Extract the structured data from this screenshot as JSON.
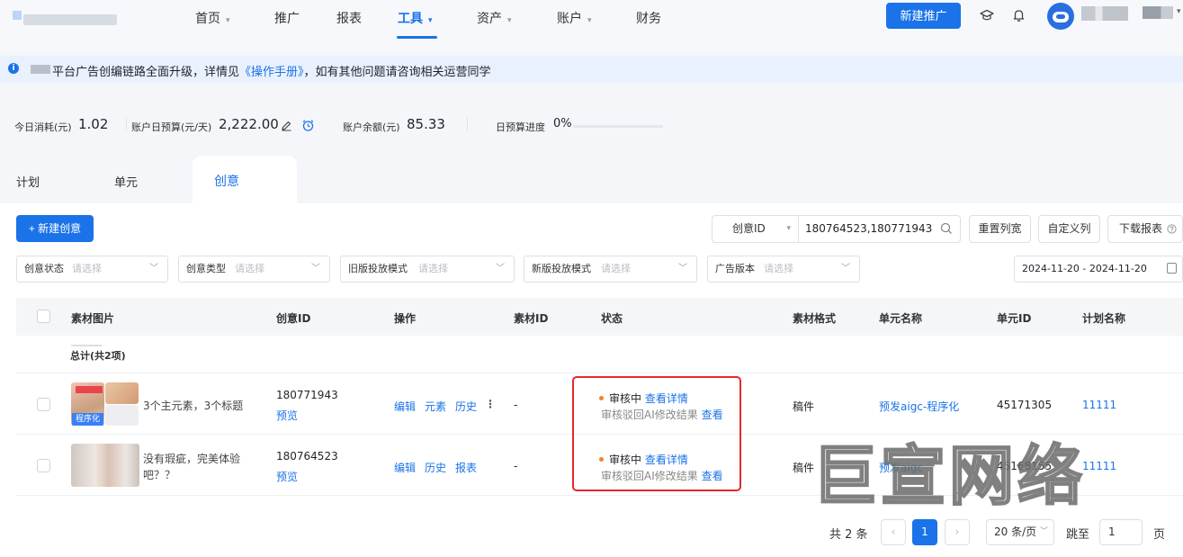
{
  "nav": {
    "items": [
      {
        "label": "首页",
        "caret": true
      },
      {
        "label": "推广",
        "caret": false
      },
      {
        "label": "报表",
        "caret": false
      },
      {
        "label": "工具",
        "caret": true,
        "active": true
      },
      {
        "label": "资产",
        "caret": true
      },
      {
        "label": "账户",
        "caret": true
      },
      {
        "label": "财务",
        "caret": false
      }
    ],
    "new_promo": "新建推广",
    "caret": "▾"
  },
  "notice": {
    "text_before": "平台广告创编链路全面升级，详情见",
    "link": "《操作手册》",
    "text_after": "，如有其他问题请咨询相关运营同学"
  },
  "stats": {
    "today_cost_label": "今日消耗(元)",
    "today_cost": "1.02",
    "daily_budget_label": "账户日预算(元/天)",
    "daily_budget": "2,222.00",
    "balance_label": "账户余额(元)",
    "balance": "85.33",
    "budget_progress_label": "日预算进度",
    "budget_progress": "0%",
    "budget_progress_fraction": 0
  },
  "tabs": [
    "计划",
    "单元",
    "创意"
  ],
  "active_tab": "创意",
  "toolbar": {
    "new_creative": "+ 新建创意",
    "search_field": "创意ID",
    "search_value": "180764523,180771943",
    "reset_columns": "重置列宽",
    "custom_columns": "自定义列",
    "download_report": "下载报表"
  },
  "filters": [
    {
      "label": "创意状态",
      "placeholder": "请选择"
    },
    {
      "label": "创意类型",
      "placeholder": "请选择"
    },
    {
      "label": "旧版投放模式",
      "placeholder": "请选择"
    },
    {
      "label": "新版投放模式",
      "placeholder": "请选择"
    },
    {
      "label": "广告版本",
      "placeholder": "请选择"
    }
  ],
  "date_range": "2024-11-20 - 2024-11-20",
  "table": {
    "headers": [
      "素材图片",
      "创意ID",
      "操作",
      "素材ID",
      "状态",
      "素材格式",
      "单元名称",
      "单元ID",
      "计划名称"
    ],
    "summary": "总计(共2项)",
    "rows": [
      {
        "title": "3个主元素，3个标题",
        "badge": "程序化",
        "id": "180771943",
        "preview": "预览",
        "actions": [
          "编辑",
          "元素",
          "历史"
        ],
        "more": "⋮",
        "material_id": "-",
        "status": "审核中",
        "status_detail": "查看详情",
        "status_sub": "审核驳回AI修改结果",
        "status_sub_link": "查看",
        "format": "稿件",
        "unit_name": "预发aigc-程序化",
        "unit_id": "45171305",
        "plan_name": "11111"
      },
      {
        "title_line1": "没有瑕疵，完美体验",
        "title_line2": "吧？？",
        "id": "180764523",
        "preview": "预览",
        "actions": [
          "编辑",
          "历史",
          "报表"
        ],
        "material_id": "-",
        "status": "审核中",
        "status_detail": "查看详情",
        "status_sub": "审核驳回AI修改结果",
        "status_sub_link": "查看",
        "format": "稿件",
        "unit_name": "预发aigc",
        "unit_id": "45168155",
        "plan_name": "11111"
      }
    ]
  },
  "watermark": "巨宣网络",
  "pagination": {
    "total": "共 2 条",
    "prev": "‹",
    "current": "1",
    "next": "›",
    "page_size": "20 条/页",
    "jump_label": "跳至",
    "jump_value": "1",
    "page_suffix": "页"
  },
  "colors": {
    "accent": "#1a73e8",
    "highlight_box": "#e4292c",
    "status_dot": "#f5822a"
  },
  "icons": [
    "info-icon",
    "edit-icon",
    "alarm-clock-icon",
    "search-icon",
    "help-icon",
    "calendar-icon",
    "graduation-cap-icon",
    "bell-icon",
    "chevron-down-icon"
  ]
}
